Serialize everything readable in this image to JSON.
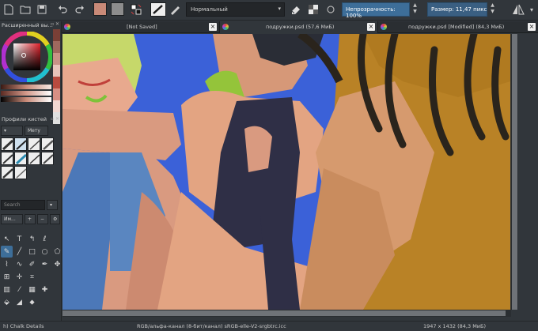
{
  "toolbar": {
    "blend_mode": "Нормальный",
    "opacity_label": "Непрозрачность: 100%",
    "size_label": "Размер: 11,47 пикс.",
    "colors": {
      "foreground": "#c98a78",
      "background": "#8d8d8d"
    }
  },
  "docker": {
    "color_title": "Расширенный вы...",
    "brush_title": "Профили кистей",
    "tag_label": "Мету",
    "search_placeholder": "Search",
    "import_label": "Им...",
    "color_strip": [
      "#7a3f36",
      "#a0685e",
      "#c89287",
      "#e8c4bb",
      "#b84a3f",
      "#d98f84",
      "#f2d8d2",
      "#e0e0e0"
    ],
    "selector_colors": {
      "hue": "#c98a78"
    }
  },
  "tabs": [
    {
      "label": "[Not Saved]",
      "active": false
    },
    {
      "label": "подружки.psd (57,6 МиБ)",
      "active": true
    },
    {
      "label": "подружки.psd [Modified] (84,3 МиБ)",
      "active": false
    }
  ],
  "status": {
    "brush": "h) Chalk Details",
    "color_space": "RGB/альфа-канал (8-бит/канал)  sRGB-elle-V2-srgbtrc.icc",
    "image_info": "1947 x 1432 (84,3 МиБ)"
  },
  "icons": [
    "new-document-icon",
    "open-icon",
    "save-icon",
    "undo-icon",
    "redo-icon",
    "swap-colors-icon",
    "brush-preset-icon",
    "eraser-icon",
    "alpha-lock-icon",
    "reload-icon",
    "mirror-icon",
    "menu-arrow-icon"
  ]
}
